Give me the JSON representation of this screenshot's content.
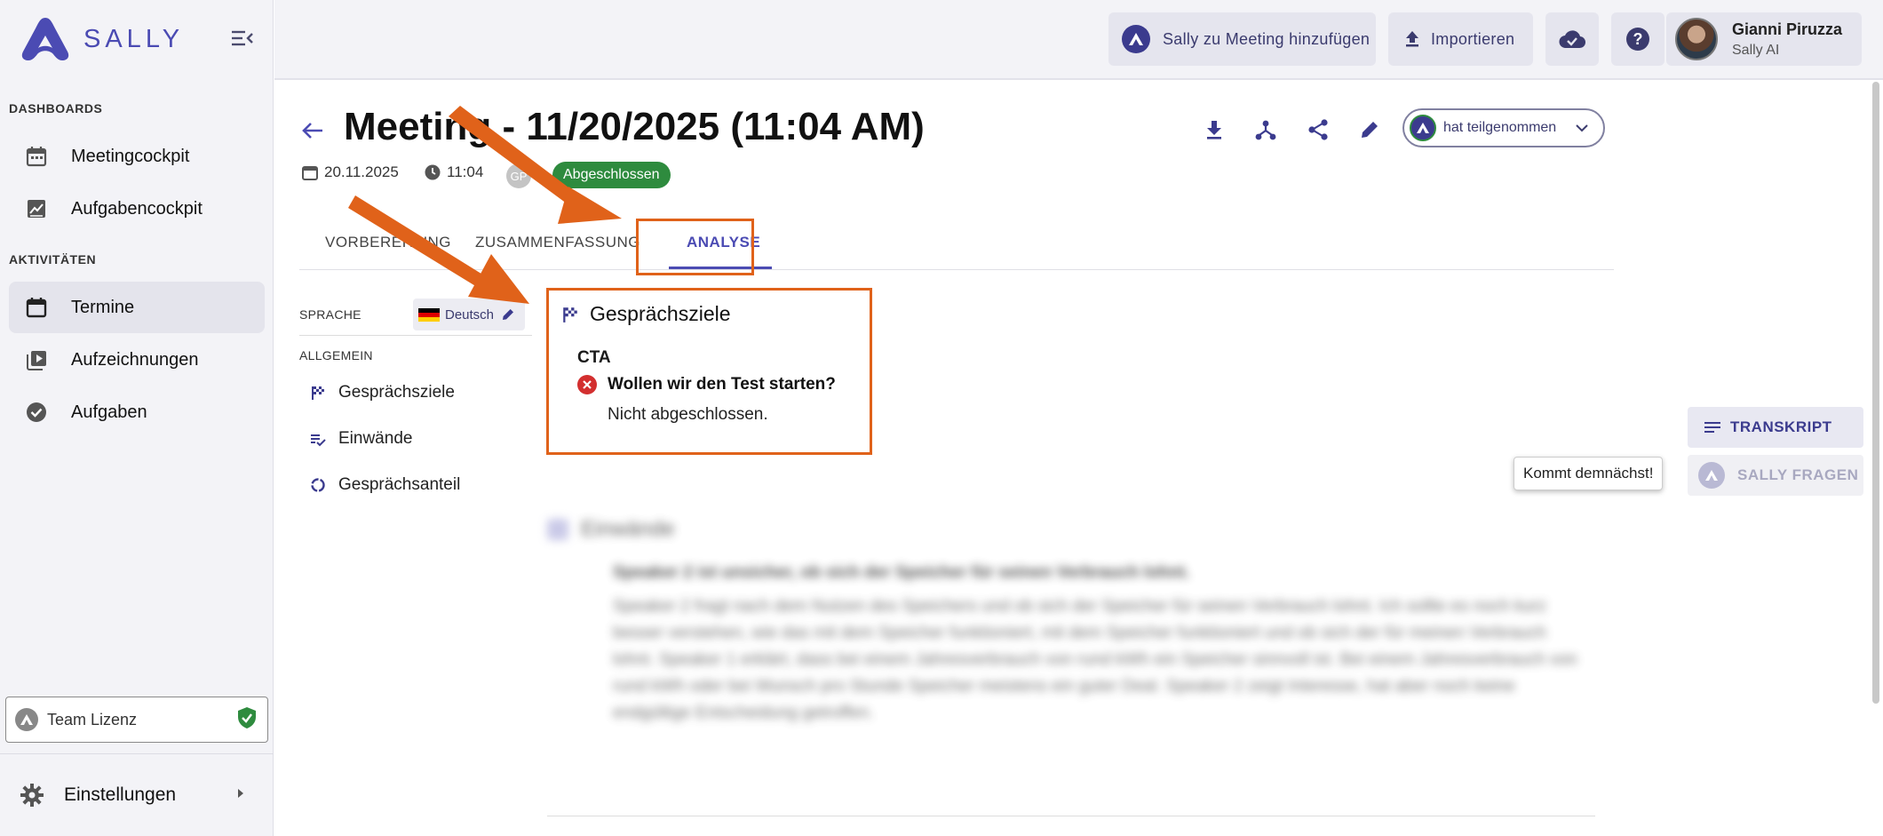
{
  "sidebar": {
    "logo_text": "SALLY",
    "sections": [
      {
        "title": "DASHBOARDS",
        "items": [
          {
            "label": "Meetingcockpit",
            "icon": "calendar-icon"
          },
          {
            "label": "Aufgabencockpit",
            "icon": "chart-icon"
          }
        ]
      },
      {
        "title": "AKTIVITÄTEN",
        "items": [
          {
            "label": "Termine",
            "icon": "calendar-icon",
            "active": true
          },
          {
            "label": "Aufzeichnungen",
            "icon": "video-library-icon"
          },
          {
            "label": "Aufgaben",
            "icon": "check-circle-icon"
          }
        ]
      }
    ],
    "license_label": "Team Lizenz",
    "settings_label": "Einstellungen"
  },
  "topbar": {
    "add_sally_label": "Sally zu Meeting hinzufügen",
    "import_label": "Importieren",
    "user_name": "Gianni Piruzza",
    "user_org": "Sally AI"
  },
  "meeting": {
    "title": "Meeting - 11/20/2025 (11:04 AM)",
    "date": "20.11.2025",
    "time": "11:04",
    "participant_initials": "GP",
    "status_badge": "Abgeschlossen",
    "attendance": "hat teilgenommen"
  },
  "tabs": [
    "VORBEREITUNG",
    "ZUSAMMENFASSUNG",
    "ANALYSE"
  ],
  "analysis": {
    "language_label": "SPRACHE",
    "language_value": "Deutsch",
    "section_label": "ALLGEMEIN",
    "links": [
      "Gesprächsziele",
      "Einwände",
      "Gesprächsanteil"
    ],
    "goals_title": "Gesprächsziele",
    "cta_label": "CTA",
    "goal_question": "Wollen wir den Test starten?",
    "goal_status": "Nicht abgeschlossen.",
    "objections_title": "Einwände",
    "objection_question": "Speaker 2 ist unsicher, ob sich der Speicher für seinen Verbrauch lohnt.",
    "objection_text": "Speaker 2 fragt nach dem Nutzen des Speichers und ob sich der Speicher für seinen Verbrauch lohnt. Ich sollte es noch kurz besser verstehen, wie das mit dem Speicher funktioniert, mit dem Speicher funktioniert und ob sich der für meinen Verbrauch lohnt. Speaker 1 erklärt, dass bei einem Jahresverbrauch von rund kWh ein Speicher sinnvoll ist. Bei einem Jahresverbrauch von rund kWh oder bei Wunsch pro Stunde Speicher meistens ein guter Deal. Speaker 2 zeigt Interesse, hat aber noch keine endgültige Entscheidung getroffen."
  },
  "right_panel": {
    "transcript_label": "TRANSKRIPT",
    "ask_sally_label": "SALLY FRAGEN",
    "tooltip": "Kommt demnächst!"
  },
  "colors": {
    "brand": "#4b4bb3",
    "annotation": "#e0621a",
    "success": "#2e8b3e",
    "error": "#d32f2f"
  }
}
